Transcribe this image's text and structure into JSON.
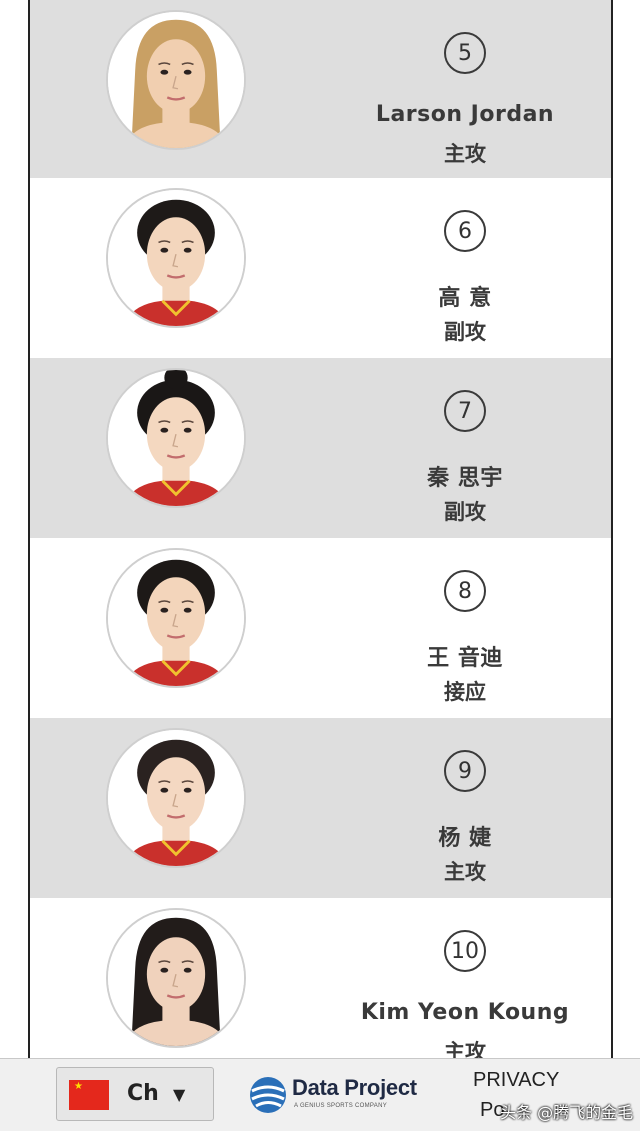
{
  "players": [
    {
      "number": "5",
      "name": "Larson Jordan",
      "position": "主攻",
      "hair": "#c9a064",
      "skin": "#f1cfb0",
      "style": "long"
    },
    {
      "number": "6",
      "name": "高 意",
      "position": "副攻",
      "hair": "#1e1a18",
      "skin": "#f3d6bd",
      "style": "tied"
    },
    {
      "number": "7",
      "name": "秦 思宇",
      "position": "副攻",
      "hair": "#1a1716",
      "skin": "#f4d8c0",
      "style": "bun"
    },
    {
      "number": "8",
      "name": "王 音迪",
      "position": "接应",
      "hair": "#1d1917",
      "skin": "#f3d5bb",
      "style": "tied"
    },
    {
      "number": "9",
      "name": "杨 婕",
      "position": "主攻",
      "hair": "#2a2220",
      "skin": "#f4d8c2",
      "style": "tied"
    },
    {
      "number": "10",
      "name": "Kim Yeon Koung",
      "position": "主攻",
      "hair": "#221c1a",
      "skin": "#f0d2bc",
      "style": "long"
    }
  ],
  "footer": {
    "language_code": "Ch",
    "flag_icon": "china-flag-icon",
    "brand_name": "Data Project",
    "brand_tagline": "A GENIUS SPORTS COMPANY",
    "privacy_line1": "PRIVACY",
    "privacy_line2": "Po",
    "watermark": "头条 @腾飞的金毛"
  },
  "colors": {
    "row_gray": "#dedede",
    "row_white": "#ffffff",
    "text": "#3a3a3a"
  }
}
